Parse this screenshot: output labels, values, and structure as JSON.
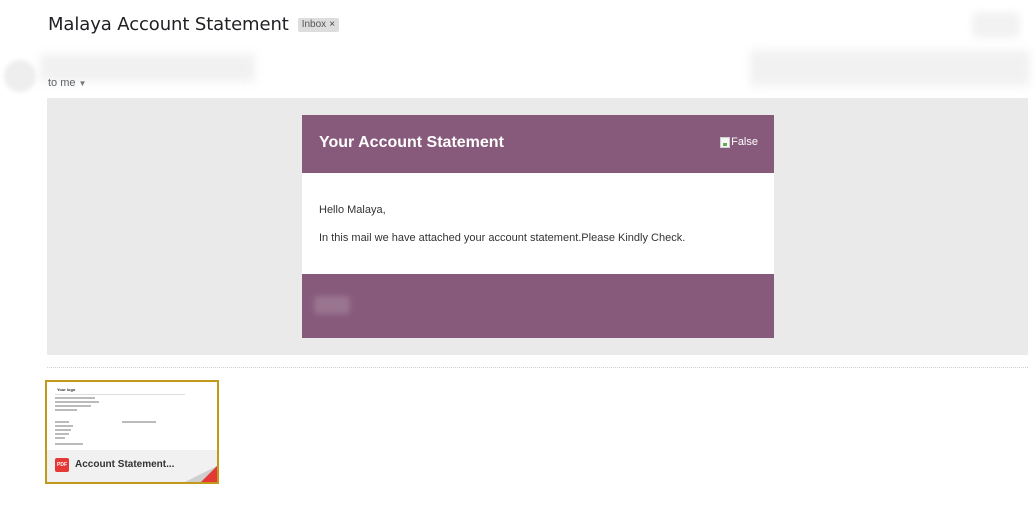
{
  "email": {
    "subject": "Malaya Account Statement",
    "label_chip": "Inbox",
    "label_chip_close": "×",
    "recipient_line": "to me",
    "recipient_caret": "▼"
  },
  "message": {
    "header_title": "Your Account Statement",
    "logo_alt": "False",
    "greeting": "Hello Malaya,",
    "body_text": "In this mail we have attached your account statement.Please Kindly Check.",
    "theme_color": "#875a7b",
    "background_color": "#eaeaea"
  },
  "attachment": {
    "type_badge": "PDF",
    "filename": "Account Statement...",
    "thumbnail_logo_text": "Your logo",
    "highlight_color": "#c29a1a"
  }
}
